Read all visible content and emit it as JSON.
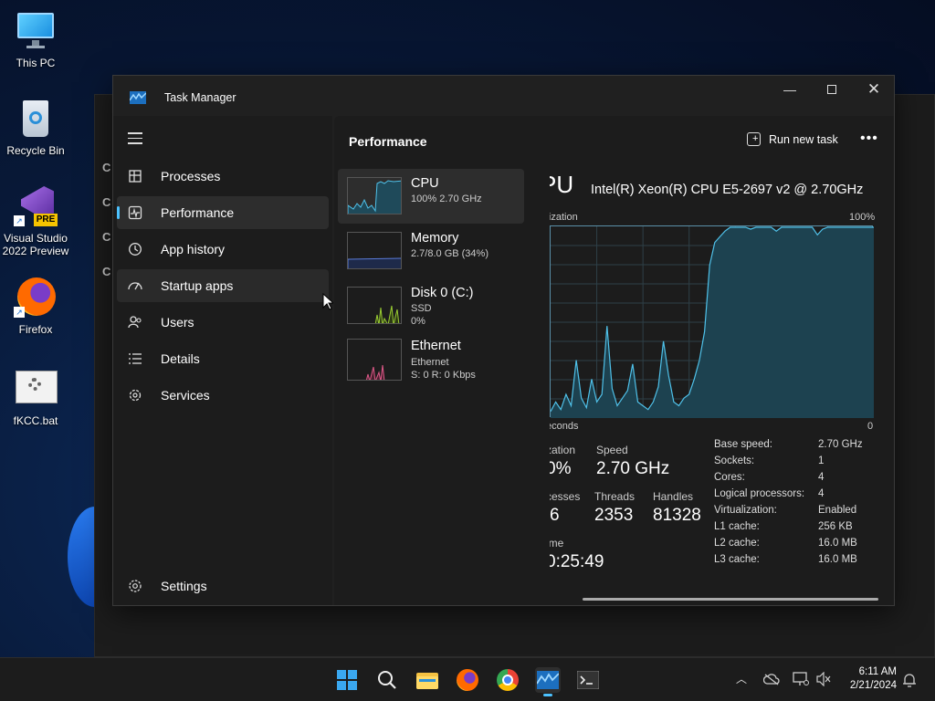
{
  "desktop": {
    "icons": [
      {
        "label": "This PC",
        "icon": "monitor-icon"
      },
      {
        "label": "Recycle Bin",
        "icon": "recycle-bin-icon"
      },
      {
        "label": "Visual Studio 2022 Preview",
        "icon": "visual-studio-icon",
        "badge": "PRE"
      },
      {
        "label": "Firefox",
        "icon": "firefox-icon"
      },
      {
        "label": "fKCC.bat",
        "icon": "batch-file-icon"
      }
    ]
  },
  "task_manager": {
    "title": "Task Manager",
    "nav": [
      {
        "label": "Processes",
        "icon": "processes-icon"
      },
      {
        "label": "Performance",
        "icon": "performance-icon",
        "active": true
      },
      {
        "label": "App history",
        "icon": "history-icon"
      },
      {
        "label": "Startup apps",
        "icon": "startup-icon"
      },
      {
        "label": "Users",
        "icon": "users-icon"
      },
      {
        "label": "Details",
        "icon": "details-icon"
      },
      {
        "label": "Services",
        "icon": "services-icon"
      }
    ],
    "settings_label": "Settings",
    "page_title": "Performance",
    "run_new_task": "Run new task",
    "more": "•••",
    "resources": [
      {
        "name": "CPU",
        "sub1": "100%  2.70 GHz",
        "color": "#4fc1e9"
      },
      {
        "name": "Memory",
        "sub1": "2.7/8.0 GB (34%)",
        "color": "#5a7bd8"
      },
      {
        "name": "Disk 0 (C:)",
        "sub1": "SSD",
        "sub2": "0%",
        "color": "#9acd32"
      },
      {
        "name": "Ethernet",
        "sub1": "Ethernet",
        "sub2": "S: 0  R: 0 Kbps",
        "color": "#e05a8a"
      }
    ],
    "detail": {
      "heading": "PU",
      "model": "Intel(R) Xeon(R) CPU E5-2697 v2 @ 2.70GHz",
      "util_label": "ilization",
      "max_label": "100%",
      "seconds_label": "econds",
      "zero_label": "0",
      "stats": {
        "util_label": "zation",
        "util_value": "0%",
        "speed_label": "Speed",
        "speed_value": "2.70 GHz",
        "proc_label": "cesses",
        "proc_value": "6",
        "threads_label": "Threads",
        "threads_value": "2353",
        "handles_label": "Handles",
        "handles_value": "81328",
        "uptime_label": "ime",
        "uptime_value": "0:25:49"
      },
      "specs": [
        {
          "k": "Base speed:",
          "v": "2.70 GHz"
        },
        {
          "k": "Sockets:",
          "v": "1"
        },
        {
          "k": "Cores:",
          "v": "4"
        },
        {
          "k": "Logical processors:",
          "v": "4"
        },
        {
          "k": "Virtualization:",
          "v": "Enabled"
        },
        {
          "k": "L1 cache:",
          "v": "256 KB"
        },
        {
          "k": "L2 cache:",
          "v": "16.0 MB"
        },
        {
          "k": "L3 cache:",
          "v": "16.0 MB"
        }
      ],
      "cpu_history_percent": [
        3,
        8,
        4,
        12,
        6,
        30,
        10,
        5,
        20,
        8,
        12,
        48,
        15,
        6,
        10,
        14,
        28,
        8,
        6,
        4,
        8,
        16,
        40,
        22,
        8,
        6,
        10,
        12,
        20,
        30,
        45,
        80,
        92,
        95,
        98,
        100,
        100,
        100,
        100,
        99,
        100,
        100,
        100,
        100,
        98,
        100,
        100,
        100,
        100,
        100,
        100,
        100,
        96,
        99,
        100,
        100,
        100,
        100,
        100,
        100,
        100,
        100,
        100,
        100
      ]
    }
  },
  "taskbar": {
    "icons": [
      "start-icon",
      "search-icon",
      "file-explorer-icon",
      "firefox-icon",
      "chrome-icon",
      "task-manager-icon",
      "terminal-icon"
    ],
    "time": "6:11 AM",
    "date": "2/21/2024"
  }
}
